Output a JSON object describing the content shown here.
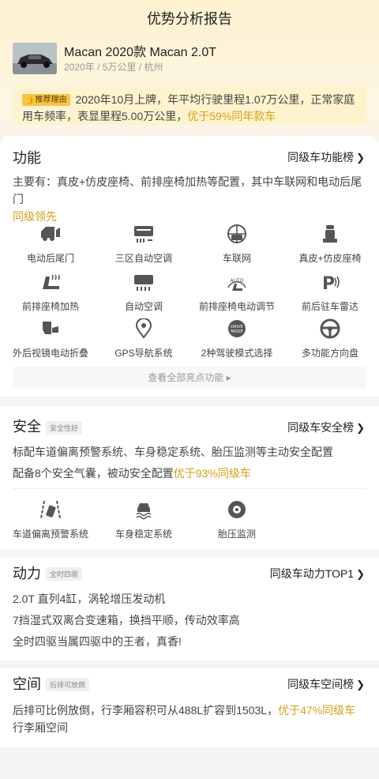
{
  "header": {
    "title": "优势分析报告"
  },
  "car": {
    "name": "Macan 2020款 Macan 2.0T",
    "meta": "2020年 / 5万公里 / 杭州"
  },
  "reason": {
    "tag": "推荐理由",
    "text": "2020年10月上牌，年平均行驶里程1.07万公里，正常家庭用车频率，表显里程5.00万公里，",
    "highlight": "优于59%同年款车"
  },
  "function": {
    "title": "功能",
    "link": "同级车功能榜",
    "summary": "主要有：真皮+仿皮座椅、前排座椅加热等配置，其中车联网和电动后尾门",
    "summary_highlight": "同级领先",
    "features": [
      {
        "label": "电动后尾门",
        "icon": "tailgate-icon"
      },
      {
        "label": "三区自动空调",
        "icon": "ac-icon"
      },
      {
        "label": "车联网",
        "icon": "connected-car-icon"
      },
      {
        "label": "真皮+仿皮座椅",
        "icon": "seat-icon"
      },
      {
        "label": "前排座椅加热",
        "icon": "seat-heating-icon"
      },
      {
        "label": "自动空调",
        "icon": "auto-ac-icon"
      },
      {
        "label": "前排座椅电动调节",
        "icon": "seat-adjust-icon"
      },
      {
        "label": "前后驻车雷达",
        "icon": "parking-radar-icon"
      },
      {
        "label": "外后视镜电动折叠",
        "icon": "mirror-fold-icon"
      },
      {
        "label": "GPS导航系统",
        "icon": "gps-icon"
      },
      {
        "label": "2种驾驶模式选择",
        "icon": "drive-mode-icon"
      },
      {
        "label": "多功能方向盘",
        "icon": "steering-wheel-icon"
      }
    ],
    "view_all": "查看全部亮点功能",
    "auto_text": "AUTO",
    "drive_mode_text1": "DRIVE",
    "drive_mode_text2": "MODE"
  },
  "safety": {
    "title": "安全",
    "badge": "安全性好",
    "link": "同级车安全榜",
    "line1": "标配车道偏离预警系统、车身稳定系统、胎压监测等主动安全配置",
    "line2": "配备8个安全气囊，被动安全配置",
    "line2_highlight": "优于93%同级车",
    "features": [
      {
        "label": "车道偏离预警系统",
        "icon": "lane-departure-icon"
      },
      {
        "label": "车身稳定系统",
        "icon": "stability-icon"
      },
      {
        "label": "胎压监测",
        "icon": "tire-pressure-icon"
      }
    ]
  },
  "power": {
    "title": "动力",
    "badge": "全时四驱",
    "link": "同级车动力TOP1",
    "lines": [
      "2.0T 直列4缸，涡轮增压发动机",
      "7挡湿式双离合变速箱，换挡平顺，传动效率高",
      "全时四驱当属四驱中的王者，真香!"
    ]
  },
  "space": {
    "title": "空间",
    "badge": "后排可放倒",
    "link": "同级车空间榜",
    "text1": "后排可比例放倒，行李厢容积可从488L扩容到1503L，",
    "highlight": "优于47%同级车",
    "text2": "行李厢空间"
  },
  "colors": {
    "accent": "#d4a017",
    "badge_bg": "#f6c544"
  }
}
